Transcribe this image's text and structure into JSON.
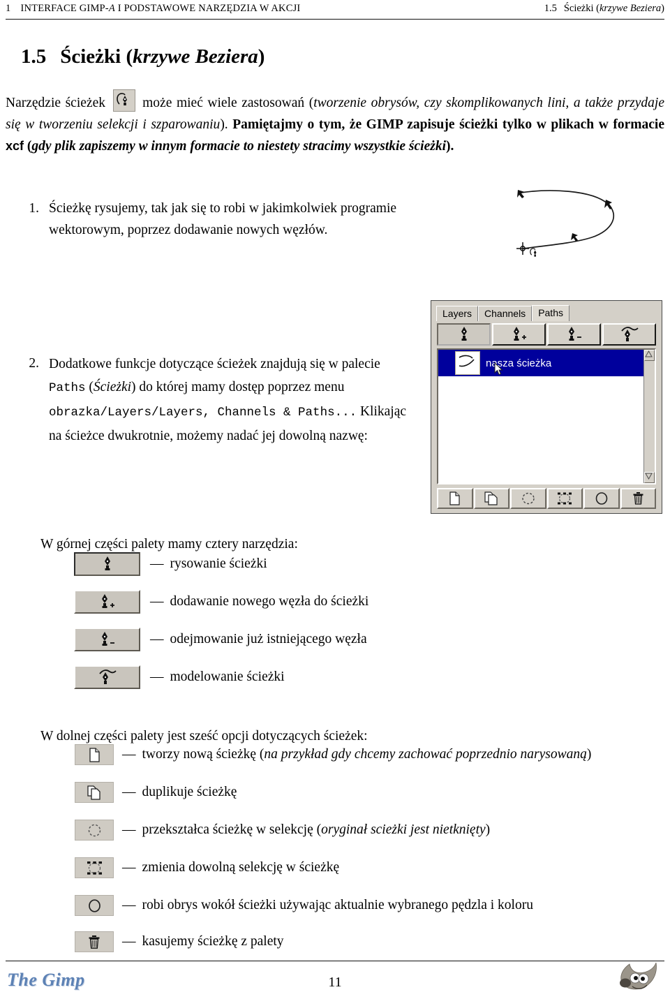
{
  "running_header": {
    "chapter_number": "1",
    "chapter_title_part1": "INTERFACE GIMP-",
    "chapter_title_italic": "A",
    "chapter_title_part2": " I PODSTAWOWE NARZĘDZIA W AKCJI",
    "section_number": "1.5",
    "section_title_plain": "Ścieżki (",
    "section_title_italic": "krzywe Beziera",
    "section_title_close": ")"
  },
  "section": {
    "number": "1.5",
    "title_plain": "Ścieżki (",
    "title_italic": "krzywe Beziera",
    "title_close": ")"
  },
  "intro": {
    "t1": "Narzędzie ścieżek ",
    "icon_name": "path-tool-icon",
    "t2": " może mieć wiele zastosowań (",
    "i1": "tworzenie obrysów, czy skomplikowanych lini, a także przydaje się w tworzeniu selekcji i szparowaniu",
    "t3": "). ",
    "b1": "Pamiętajmy o tym, że GIMP zapisuje ścieżki tylko w plikach w formacie ",
    "b1_mono": "xcf",
    "b2": " (",
    "bi1": "gdy plik zapiszemy w innym formacie to niestety stracimy wszystkie ścieżki",
    "b3": ")."
  },
  "items": [
    {
      "marker": "1.",
      "text": "Ścieżkę rysujemy, tak jak się to robi w jakimkolwiek programie wektorowym, poprzez dodawanie nowych węzłów."
    },
    {
      "marker": "2.",
      "seg1": "Dodatkowe funkcje dotyczące ścieżek znajdują się w palecie ",
      "mono1": "Paths",
      "seg2": " (",
      "ital1": "Ścieżki",
      "seg3": ") do której mamy dostęp poprzez menu ",
      "mono2": "obrazka/Layers/Layers, Channels & Paths...",
      "seg4": " Klikając na ścieżce dwukrotnie, możemy nadać jej dowolną nazwę:"
    }
  ],
  "dialog": {
    "name": "paths-dialog",
    "tabs": [
      {
        "label": "Layers",
        "active": false
      },
      {
        "label": "Channels",
        "active": false
      },
      {
        "label": "Paths",
        "active": true
      }
    ],
    "tool_buttons": [
      {
        "name": "draw-path-button",
        "icon": "pen-nib-icon",
        "pressed": true
      },
      {
        "name": "add-node-button",
        "icon": "pen-nib-plus-icon",
        "pressed": false
      },
      {
        "name": "remove-node-button",
        "icon": "pen-nib-minus-icon",
        "pressed": false
      },
      {
        "name": "edit-path-button",
        "icon": "pen-nib-curve-icon",
        "pressed": false
      }
    ],
    "path_entry": {
      "label": "nasza ścieżka",
      "selected": true,
      "selection_color": "#00009c",
      "text_color": "#ffffff"
    },
    "bottom_buttons": [
      {
        "name": "new-path-button",
        "icon": "new-page-icon"
      },
      {
        "name": "duplicate-path-button",
        "icon": "duplicate-pages-icon"
      },
      {
        "name": "path-to-selection-button",
        "icon": "dashed-circle-icon"
      },
      {
        "name": "selection-to-path-button",
        "icon": "selection-nodes-icon"
      },
      {
        "name": "stroke-path-button",
        "icon": "circle-outline-icon"
      },
      {
        "name": "delete-path-button",
        "icon": "trash-icon"
      }
    ]
  },
  "top_tools_heading": "W górnej części palety mamy cztery narzędzia:",
  "top_tools": [
    {
      "icon": "pen-nib-icon",
      "dash": "—",
      "label": "rysowanie ścieżki"
    },
    {
      "icon": "pen-nib-plus-icon",
      "dash": "—",
      "label": "dodawanie nowego węzła do ścieżki"
    },
    {
      "icon": "pen-nib-minus-icon",
      "dash": "—",
      "label": "odejmowanie już istniejącego węzła"
    },
    {
      "icon": "pen-nib-curve-icon",
      "dash": "—",
      "label": "modelowanie ścieżki"
    }
  ],
  "bottom_opts_heading": "W dolnej części palety jest sześć opcji dotyczących ścieżek:",
  "bottom_opts": [
    {
      "icon": "new-page-icon",
      "dash": "—",
      "plain": "tworzy nową ścieżkę (",
      "italic": "na przykład gdy chcemy zachować poprzednio narysowaną",
      "close": ")"
    },
    {
      "icon": "duplicate-pages-icon",
      "dash": "—",
      "plain": "duplikuje ścieżkę",
      "italic": "",
      "close": ""
    },
    {
      "icon": "dashed-circle-icon",
      "dash": "—",
      "plain": "przekształca ścieżkę w selekcję (",
      "italic": "oryginał scieżki jest nietknięty",
      "close": ")"
    },
    {
      "icon": "selection-nodes-icon",
      "dash": "—",
      "plain": "zmienia dowolną selekcję w ścieżkę",
      "italic": "",
      "close": ""
    },
    {
      "icon": "circle-outline-icon",
      "dash": "—",
      "plain": "robi obrys wokół ścieżki używając aktualnie wybranego pędzla i koloru",
      "italic": "",
      "close": ""
    },
    {
      "icon": "trash-icon",
      "dash": "—",
      "plain": "kasujemy ścieżkę z palety",
      "italic": "",
      "close": ""
    }
  ],
  "footer": {
    "logo_text": "The Gimp",
    "logo_color": "#5d82b5",
    "page_number": "11",
    "mascot_name": "wilber-mascot-icon"
  }
}
